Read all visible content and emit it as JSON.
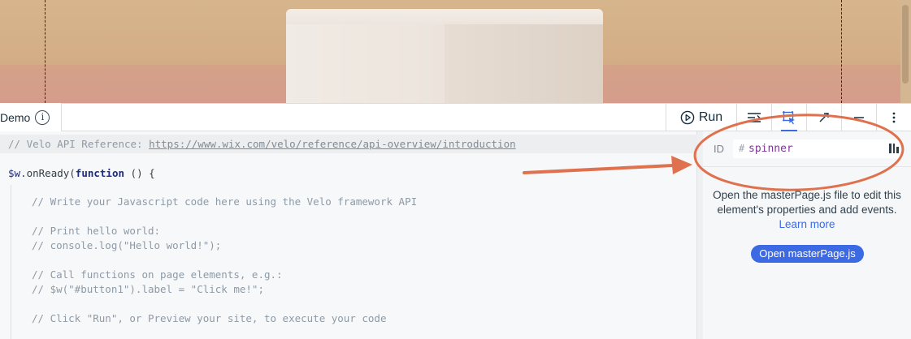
{
  "panel": {
    "tab_label": "Demo",
    "info_glyph": "i",
    "run_label": "Run"
  },
  "editor": {
    "lines": [
      "// Velo API Reference: ",
      "https://www.wix.com/velo/reference/api-overview/introduction",
      "$w",
      ".onReady(",
      "function",
      " () {",
      "// Write your Javascript code here using the Velo framework API",
      "// Print hello world:",
      "// console.log(\"Hello world!\");",
      "// Call functions on page elements, e.g.:",
      "// $w(\"#button1\").label = \"Click me!\";",
      "// Click \"Run\", or Preview your site, to execute your code"
    ]
  },
  "properties": {
    "id_label": "ID",
    "id_hash": "#",
    "id_value": "spinner",
    "message": "Open the masterPage.js file to edit this element's properties and add events.",
    "learn_more": "Learn more",
    "open_button": "Open masterPage.js"
  },
  "icons": {
    "info": "info-icon",
    "run": "play-circle-icon",
    "props": "properties-panel-icon",
    "select": "select-element-icon",
    "expand": "expand-icon",
    "minimize": "minimize-icon",
    "more": "more-vertical-icon",
    "id_end": "element-type-icon"
  },
  "colors": {
    "accent": "#3b6ae4",
    "annotation": "#e0714e",
    "id_value": "#7a3894"
  }
}
